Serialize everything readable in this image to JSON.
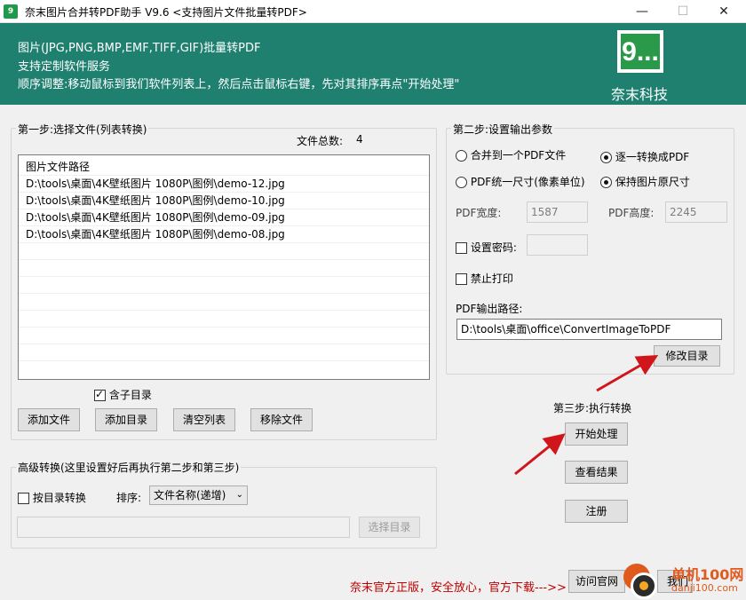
{
  "window": {
    "title": "奈末图片合并转PDF助手 V9.6  <支持图片文件批量转PDF>",
    "minimize": "—",
    "maximize": "☐",
    "close": "✕"
  },
  "banner": {
    "lines": [
      "图片(JPG,PNG,BMP,EMF,TIFF,GIF)批量转PDF",
      "支持定制软件服务",
      "顺序调整:移动鼠标到我们软件列表上，然后点击鼠标右键，先对其排序再点\"开始处理\""
    ],
    "logo_text": "9...",
    "brand": "奈末科技",
    "bg_color": "#1f8070"
  },
  "step1": {
    "label": "第一步:选择文件(列表转换)",
    "file_count_label": "文件总数:",
    "file_count": "4",
    "list_header": "图片文件路径",
    "files": [
      "D:\\tools\\桌面\\4K壁纸图片 1080P\\图例\\demo-12.jpg",
      "D:\\tools\\桌面\\4K壁纸图片 1080P\\图例\\demo-10.jpg",
      "D:\\tools\\桌面\\4K壁纸图片 1080P\\图例\\demo-09.jpg",
      "D:\\tools\\桌面\\4K壁纸图片 1080P\\图例\\demo-08.jpg"
    ],
    "include_subdir": "含子目录",
    "include_subdir_checked": true,
    "buttons": {
      "add_file": "添加文件",
      "add_dir": "添加目录",
      "clear_list": "清空列表",
      "remove_file": "移除文件"
    }
  },
  "advanced": {
    "label": "高级转换(这里设置好后再执行第二步和第三步)",
    "by_dir": "按目录转换",
    "by_dir_checked": false,
    "sort_label": "排序:",
    "sort_value": "文件名称(递增)",
    "dir_path": "",
    "choose_dir": "选择目录"
  },
  "step2": {
    "label": "第二步:设置输出参数",
    "opt_merge": "合并到一个PDF文件",
    "opt_each": "逐一转换成PDF",
    "opt_uniform": "PDF统一尺寸(像素单位)",
    "opt_original": "保持图片原尺寸",
    "pdf_width_label": "PDF宽度:",
    "pdf_width": "1587",
    "pdf_height_label": "PDF高度:",
    "pdf_height": "2245",
    "set_password": "设置密码:",
    "password": "",
    "no_print": "禁止打印",
    "output_path_label": "PDF输出路径:",
    "output_path": "D:\\tools\\桌面\\office\\ConvertImageToPDF",
    "change_dir": "修改目录"
  },
  "step3": {
    "label": "第三步:执行转换",
    "start": "开始处理",
    "view_result": "查看结果",
    "register": "注册"
  },
  "footer": {
    "notice": "奈末官方正版，安全放心，官方下载--->>",
    "visit_site": "访问官网",
    "contact": "我们"
  },
  "watermark": {
    "site": "单机100网",
    "domain": "danji100.com"
  },
  "colors": {
    "banner": "#1f8070",
    "arrow": "#d0161b",
    "footer_text": "#c00000"
  }
}
